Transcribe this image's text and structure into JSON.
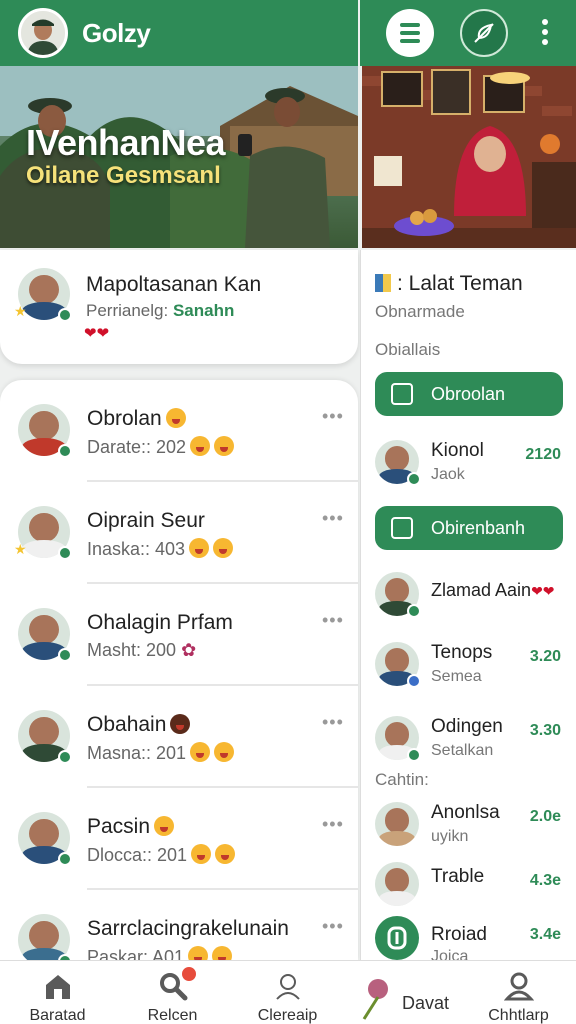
{
  "header": {
    "app_title": "Golzy",
    "menu_icon": "menu-lines-icon",
    "feather_icon": "feather-icon",
    "more_icon": "kebab-icon"
  },
  "hero": {
    "title": "IVenhanNea",
    "subtitle": "Oilane Gesmsanl"
  },
  "featured": {
    "title": "Mapoltasanan Kan",
    "subtitle_prefix": "Perrianelg:",
    "subtitle_value": "Sanahn",
    "hearts": "❤❤"
  },
  "chats": [
    {
      "name": "Obrolan",
      "preview": "Darate:: 202",
      "dots": "•••"
    },
    {
      "name": "Oiprain Seur",
      "preview": "Inaska:: 403",
      "dots": "•••"
    },
    {
      "name": "Ohalagin Prfam",
      "preview": "Masht: 200",
      "dots": "•••"
    },
    {
      "name": "Obahain",
      "preview": "Masna:: 201",
      "dots": "•••"
    },
    {
      "name": "Pacsin",
      "preview": "Dlocca:: 201",
      "dots": "•••"
    },
    {
      "name": "Sarrclacingrakelunain",
      "preview": "Paskar: A01",
      "dots": "•••"
    }
  ],
  "right_panel": {
    "header": ": Lalat Teman",
    "sub": "Obnarmade",
    "section1": "Obiallais",
    "button1": "Obroolan",
    "button2": "Obirenbanh",
    "section2": "Cahtin:",
    "items_a": [
      {
        "name": "Kionol",
        "sub": "Jaok",
        "value": "2120"
      }
    ],
    "items_b": [
      {
        "name": "Zlamad Aain",
        "sub": "",
        "value": "",
        "hearts": "❤❤"
      },
      {
        "name": "Tenops",
        "sub": "Semea",
        "value": "3.20"
      },
      {
        "name": "Odingen",
        "sub": "Setalkan",
        "value": "3.30"
      }
    ],
    "items_c": [
      {
        "name": "Anonlsa",
        "sub": "uyikn",
        "value": "2.0e"
      },
      {
        "name": "Trable",
        "sub": "",
        "value": "4.3e"
      },
      {
        "name": "Rroiad",
        "sub": "Joica",
        "value": "3.4e"
      }
    ]
  },
  "nav": [
    {
      "label": "Baratad",
      "icon": "home-icon"
    },
    {
      "label": "Relcen",
      "icon": "search-icon"
    },
    {
      "label": "Clereaip",
      "icon": "profile-outline-icon"
    },
    {
      "label": "Davat",
      "icon": "flower-icon"
    },
    {
      "label": "Chhtlarp",
      "icon": "user-icon"
    }
  ],
  "colors": {
    "brand_green": "#2e8b57",
    "heart_red": "#d0102a",
    "badge_red": "#e74c3c"
  }
}
